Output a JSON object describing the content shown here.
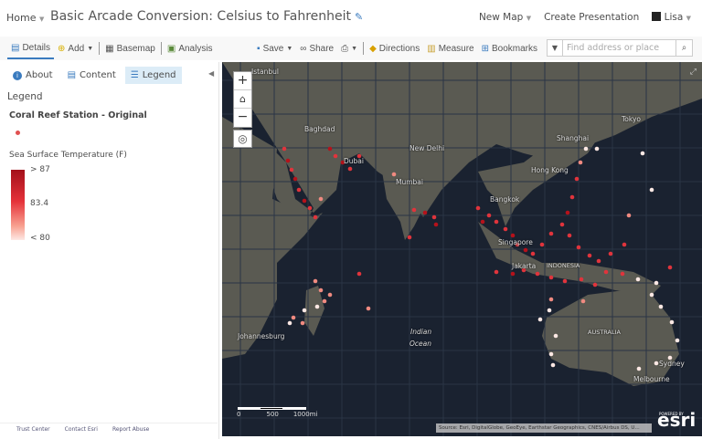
{
  "header": {
    "home": "Home",
    "title": "Basic Arcade Conversion: Celsius to Fahrenheit",
    "new_map": "New Map",
    "create_presentation": "Create Presentation",
    "user": "Lisa"
  },
  "toolbar": {
    "details": "Details",
    "add": "Add",
    "basemap": "Basemap",
    "analysis": "Analysis",
    "save": "Save",
    "share": "Share",
    "directions": "Directions",
    "measure": "Measure",
    "bookmarks": "Bookmarks",
    "search_placeholder": "Find address or place"
  },
  "panel": {
    "tabs": [
      "About",
      "Content",
      "Legend"
    ],
    "selected_tab": "Legend",
    "legend_heading": "Legend",
    "layer": "Coral Reef Station - Original",
    "field": "Sea Surface Temperature (F)",
    "ramp": {
      "max": "> 87",
      "mid": "83.4",
      "min": "< 80",
      "colors": [
        "#a3101a",
        "#e5323a",
        "#fde8e4"
      ]
    }
  },
  "footer": {
    "links": [
      "Trust Center",
      "Contact Esri",
      "Report Abuse"
    ]
  },
  "map": {
    "labels": [
      "Istanbul",
      "Baghdad",
      "Dubai",
      "New Delhi",
      "Mumbai",
      "Shanghai",
      "Tokyo",
      "Hong Kong",
      "Bangkok",
      "Singapore",
      "Jakarta",
      "INDONESIA",
      "Indian",
      "Ocean",
      "Johannesburg",
      "AUSTRALIA",
      "Sydney",
      "Melbourne"
    ],
    "scale": {
      "s0": "0",
      "s1": "500",
      "s2": "1000mi"
    },
    "attribution": "Source: Esri, DigitalGlobe, GeoEye, Earthstar Geographics, CNES/Airbus DS, U...",
    "logo": "esri",
    "logo_tag": "POWERED BY"
  }
}
